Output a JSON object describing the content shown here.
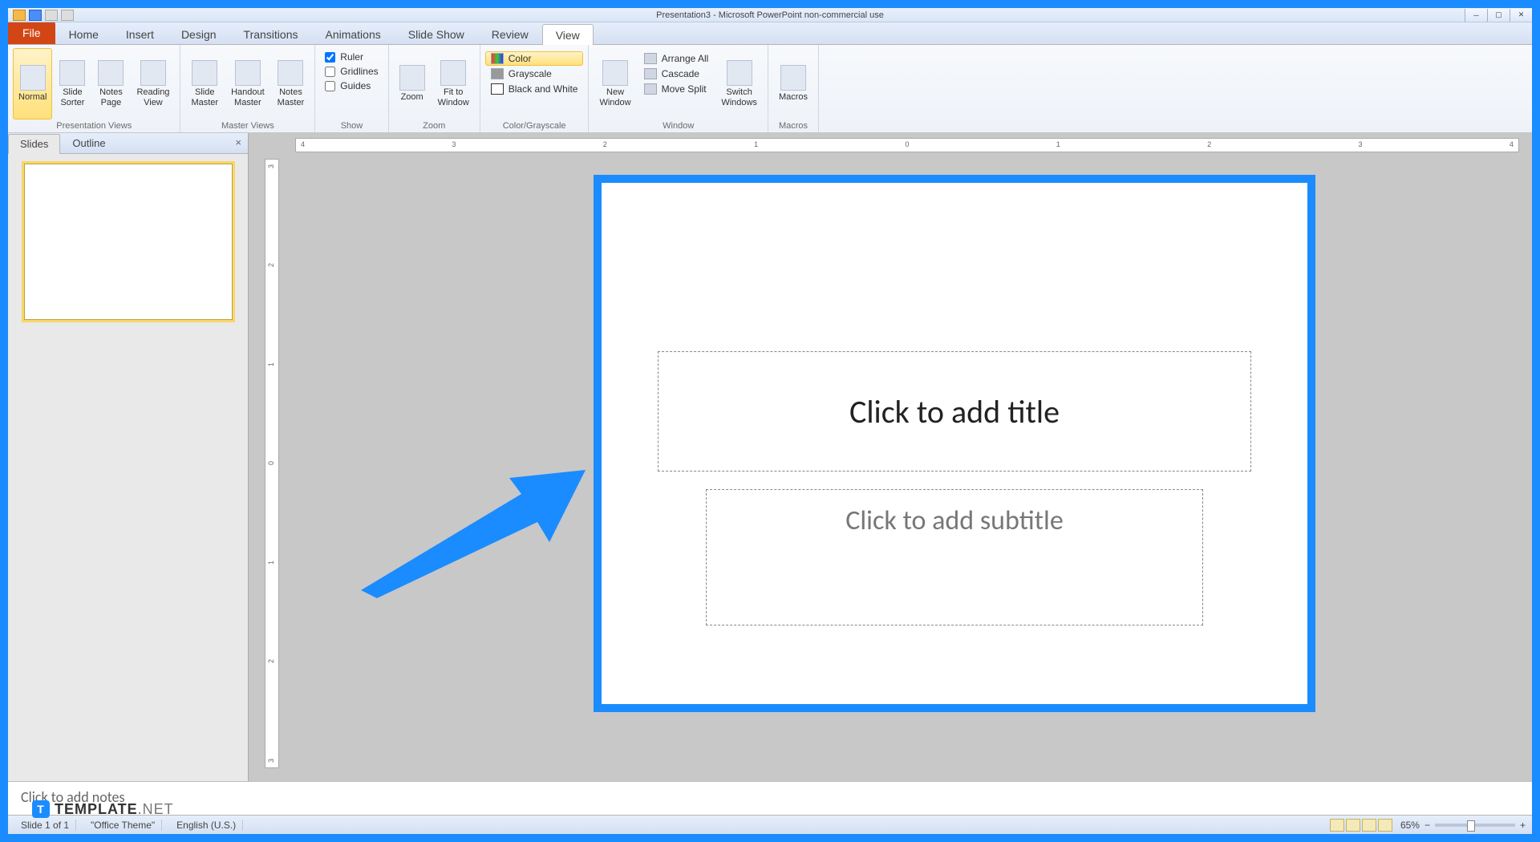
{
  "title_bar": {
    "text": "Presentation3 - Microsoft PowerPoint non-commercial use"
  },
  "tabs": {
    "file": "File",
    "items": [
      "Home",
      "Insert",
      "Design",
      "Transitions",
      "Animations",
      "Slide Show",
      "Review",
      "View"
    ],
    "active": "View"
  },
  "ribbon": {
    "presentation_views": {
      "label": "Presentation Views",
      "normal": "Normal",
      "slide_sorter": "Slide\nSorter",
      "notes_page": "Notes\nPage",
      "reading_view": "Reading\nView"
    },
    "master_views": {
      "label": "Master Views",
      "slide_master": "Slide\nMaster",
      "handout_master": "Handout\nMaster",
      "notes_master": "Notes\nMaster"
    },
    "show": {
      "label": "Show",
      "ruler": "Ruler",
      "gridlines": "Gridlines",
      "guides": "Guides"
    },
    "zoom": {
      "label": "Zoom",
      "zoom_btn": "Zoom",
      "fit": "Fit to\nWindow"
    },
    "color_grayscale": {
      "label": "Color/Grayscale",
      "color": "Color",
      "grayscale": "Grayscale",
      "bw": "Black and White"
    },
    "window": {
      "label": "Window",
      "new_window": "New\nWindow",
      "arrange_all": "Arrange All",
      "cascade": "Cascade",
      "move_split": "Move Split",
      "switch": "Switch\nWindows"
    },
    "macros": {
      "label": "Macros",
      "macros_btn": "Macros"
    }
  },
  "left_pane": {
    "slides_tab": "Slides",
    "outline_tab": "Outline",
    "close": "×"
  },
  "ruler": {
    "h_ticks": [
      "4",
      "3",
      "2",
      "1",
      "0",
      "1",
      "2",
      "3",
      "4"
    ],
    "v_ticks": [
      "3",
      "2",
      "1",
      "0",
      "1",
      "2",
      "3"
    ]
  },
  "slide": {
    "title_placeholder": "Click to add title",
    "subtitle_placeholder": "Click to add subtitle"
  },
  "notes": {
    "placeholder": "Click to add notes"
  },
  "status": {
    "slide_count": "Slide 1 of 1",
    "theme": "\"Office Theme\"",
    "language": "English (U.S.)",
    "zoom_pct": "65%",
    "plus": "+"
  },
  "watermark": {
    "brand_strong": "TEMPLATE",
    "brand_light": ".NET",
    "icon_letter": "T"
  }
}
